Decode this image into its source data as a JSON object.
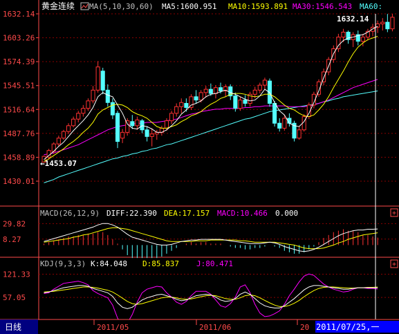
{
  "main_panel": {
    "title": "黄金连续",
    "ma_header": "MA(5,10,30,60)",
    "ma5": "MA5:1600.951",
    "ma10": "MA10:1593.891",
    "ma30": "MA30:1546.543",
    "ma60": "MA60:",
    "y_ticks": [
      "1632.14",
      "1603.26",
      "1574.39",
      "1545.51",
      "1516.64",
      "1487.76",
      "1458.89",
      "1430.01"
    ],
    "max_label": "1632.14",
    "min_label": "←1453.07"
  },
  "macd_panel": {
    "header": "MACD(26,12,9)",
    "diff": "DIFF:22.390",
    "dea": "DEA:17.157",
    "macd": "MACD:10.466",
    "extra": "0.000",
    "y_ticks": [
      "29.82",
      "8.27"
    ]
  },
  "kdj_panel": {
    "header": "KDJ(9,3,3)",
    "k": "K:84.048",
    "d": "D:85.837",
    "j": "J:80.471",
    "y_ticks": [
      "121.33",
      "57.05"
    ]
  },
  "bottom_bar": {
    "period": "日线",
    "x_labels": [
      "2011/05",
      "2011/06",
      "20"
    ],
    "cursor_date": "2011/07/25,一"
  },
  "colors": {
    "background": "#000000",
    "up": "#ff3232",
    "down": "#54ffff",
    "ma5": "#ffffff",
    "ma10": "#ffff00",
    "ma30": "#ff00ff",
    "ma60": "#00ff00",
    "grid": "#8b0000",
    "axis_text": "#ff4a4a"
  },
  "chart_data": [
    {
      "type": "candlestick",
      "title": "黄金连续",
      "ylim": [
        1430.01,
        1632.14
      ],
      "candles": [
        {
          "o": 1453,
          "h": 1461,
          "l": 1453,
          "c": 1460
        },
        {
          "o": 1459,
          "h": 1469,
          "l": 1456,
          "c": 1467
        },
        {
          "o": 1466,
          "h": 1477,
          "l": 1463,
          "c": 1475
        },
        {
          "o": 1475,
          "h": 1485,
          "l": 1472,
          "c": 1482
        },
        {
          "o": 1482,
          "h": 1492,
          "l": 1480,
          "c": 1490
        },
        {
          "o": 1490,
          "h": 1500,
          "l": 1487,
          "c": 1497
        },
        {
          "o": 1497,
          "h": 1508,
          "l": 1495,
          "c": 1505
        },
        {
          "o": 1505,
          "h": 1515,
          "l": 1501,
          "c": 1512
        },
        {
          "o": 1512,
          "h": 1522,
          "l": 1508,
          "c": 1518
        },
        {
          "o": 1518,
          "h": 1530,
          "l": 1515,
          "c": 1527
        },
        {
          "o": 1527,
          "h": 1545,
          "l": 1524,
          "c": 1540
        },
        {
          "o": 1540,
          "h": 1575,
          "l": 1537,
          "c": 1568
        },
        {
          "o": 1563,
          "h": 1567,
          "l": 1535,
          "c": 1540
        },
        {
          "o": 1540,
          "h": 1547,
          "l": 1520,
          "c": 1525
        },
        {
          "o": 1525,
          "h": 1530,
          "l": 1505,
          "c": 1510
        },
        {
          "o": 1512,
          "h": 1515,
          "l": 1470,
          "c": 1478
        },
        {
          "o": 1482,
          "h": 1493,
          "l": 1476,
          "c": 1489
        },
        {
          "o": 1489,
          "h": 1506,
          "l": 1485,
          "c": 1503
        },
        {
          "o": 1502,
          "h": 1510,
          "l": 1493,
          "c": 1497
        },
        {
          "o": 1497,
          "h": 1508,
          "l": 1492,
          "c": 1504
        },
        {
          "o": 1503,
          "h": 1505,
          "l": 1488,
          "c": 1492
        },
        {
          "o": 1492,
          "h": 1496,
          "l": 1478,
          "c": 1484
        },
        {
          "o": 1484,
          "h": 1494,
          "l": 1472,
          "c": 1487
        },
        {
          "o": 1487,
          "h": 1492,
          "l": 1480,
          "c": 1489
        },
        {
          "o": 1489,
          "h": 1497,
          "l": 1485,
          "c": 1494
        },
        {
          "o": 1494,
          "h": 1506,
          "l": 1491,
          "c": 1503
        },
        {
          "o": 1503,
          "h": 1515,
          "l": 1499,
          "c": 1512
        },
        {
          "o": 1512,
          "h": 1524,
          "l": 1508,
          "c": 1520
        },
        {
          "o": 1520,
          "h": 1530,
          "l": 1512,
          "c": 1525
        },
        {
          "o": 1524,
          "h": 1530,
          "l": 1514,
          "c": 1519
        },
        {
          "o": 1519,
          "h": 1535,
          "l": 1516,
          "c": 1532
        },
        {
          "o": 1532,
          "h": 1540,
          "l": 1524,
          "c": 1528
        },
        {
          "o": 1528,
          "h": 1540,
          "l": 1525,
          "c": 1537
        },
        {
          "o": 1537,
          "h": 1545,
          "l": 1531,
          "c": 1541
        },
        {
          "o": 1541,
          "h": 1548,
          "l": 1533,
          "c": 1536
        },
        {
          "o": 1536,
          "h": 1546,
          "l": 1530,
          "c": 1543
        },
        {
          "o": 1543,
          "h": 1549,
          "l": 1536,
          "c": 1539
        },
        {
          "o": 1539,
          "h": 1547,
          "l": 1532,
          "c": 1544
        },
        {
          "o": 1544,
          "h": 1547,
          "l": 1528,
          "c": 1533
        },
        {
          "o": 1533,
          "h": 1537,
          "l": 1514,
          "c": 1518
        },
        {
          "o": 1518,
          "h": 1532,
          "l": 1515,
          "c": 1528
        },
        {
          "o": 1528,
          "h": 1534,
          "l": 1520,
          "c": 1524
        },
        {
          "o": 1524,
          "h": 1538,
          "l": 1520,
          "c": 1535
        },
        {
          "o": 1535,
          "h": 1544,
          "l": 1530,
          "c": 1540
        },
        {
          "o": 1540,
          "h": 1549,
          "l": 1536,
          "c": 1546
        },
        {
          "o": 1546,
          "h": 1555,
          "l": 1540,
          "c": 1552
        },
        {
          "o": 1551,
          "h": 1554,
          "l": 1520,
          "c": 1524
        },
        {
          "o": 1524,
          "h": 1527,
          "l": 1496,
          "c": 1500
        },
        {
          "o": 1500,
          "h": 1506,
          "l": 1490,
          "c": 1494
        },
        {
          "o": 1494,
          "h": 1510,
          "l": 1491,
          "c": 1506
        },
        {
          "o": 1506,
          "h": 1512,
          "l": 1496,
          "c": 1500
        },
        {
          "o": 1500,
          "h": 1503,
          "l": 1478,
          "c": 1482
        },
        {
          "o": 1482,
          "h": 1496,
          "l": 1480,
          "c": 1492
        },
        {
          "o": 1492,
          "h": 1511,
          "l": 1490,
          "c": 1508
        },
        {
          "o": 1508,
          "h": 1525,
          "l": 1505,
          "c": 1522
        },
        {
          "o": 1522,
          "h": 1538,
          "l": 1518,
          "c": 1535
        },
        {
          "o": 1535,
          "h": 1553,
          "l": 1532,
          "c": 1550
        },
        {
          "o": 1550,
          "h": 1566,
          "l": 1546,
          "c": 1562
        },
        {
          "o": 1562,
          "h": 1580,
          "l": 1558,
          "c": 1577
        },
        {
          "o": 1577,
          "h": 1594,
          "l": 1573,
          "c": 1590
        },
        {
          "o": 1590,
          "h": 1608,
          "l": 1586,
          "c": 1604
        },
        {
          "o": 1604,
          "h": 1614,
          "l": 1598,
          "c": 1610
        },
        {
          "o": 1610,
          "h": 1612,
          "l": 1596,
          "c": 1601
        },
        {
          "o": 1601,
          "h": 1610,
          "l": 1592,
          "c": 1607
        },
        {
          "o": 1607,
          "h": 1612,
          "l": 1594,
          "c": 1599
        },
        {
          "o": 1599,
          "h": 1608,
          "l": 1593,
          "c": 1604
        },
        {
          "o": 1604,
          "h": 1614,
          "l": 1600,
          "c": 1611
        },
        {
          "o": 1611,
          "h": 1620,
          "l": 1605,
          "c": 1616
        },
        {
          "o": 1616,
          "h": 1624,
          "l": 1609,
          "c": 1620
        },
        {
          "o": 1620,
          "h": 1627,
          "l": 1612,
          "c": 1622
        },
        {
          "o": 1622,
          "h": 1632,
          "l": 1610,
          "c": 1614
        },
        {
          "o": 1614,
          "h": 1632,
          "l": 1611,
          "c": 1628
        }
      ],
      "ma5": [
        1456,
        1461,
        1466,
        1472,
        1477,
        1484,
        1491,
        1497,
        1503,
        1510,
        1519,
        1532,
        1537,
        1534,
        1532,
        1522,
        1512,
        1499,
        1494,
        1493,
        1497,
        1496,
        1493,
        1489,
        1489,
        1492,
        1497,
        1503,
        1511,
        1516,
        1522,
        1524,
        1527,
        1532,
        1535,
        1536,
        1538,
        1540,
        1537,
        1535,
        1532,
        1529,
        1527,
        1528,
        1533,
        1541,
        1537,
        1525,
        1515,
        1510,
        1500,
        1497,
        1496,
        1502,
        1512,
        1525,
        1539,
        1555,
        1569,
        1584,
        1594,
        1600,
        1603,
        1604,
        1606,
        1607,
        1610,
        1614,
        1617
      ],
      "ma10": [
        1454,
        1457,
        1461,
        1465,
        1469,
        1474,
        1478,
        1483,
        1489,
        1494,
        1501,
        1511,
        1516,
        1519,
        1522,
        1523,
        1522,
        1519,
        1514,
        1511,
        1509,
        1506,
        1501,
        1496,
        1494,
        1494,
        1496,
        1498,
        1502,
        1505,
        1509,
        1511,
        1514,
        1519,
        1523,
        1526,
        1530,
        1532,
        1535,
        1536,
        1536,
        1535,
        1533,
        1532,
        1533,
        1535,
        1535,
        1532,
        1527,
        1522,
        1518,
        1516,
        1512,
        1509,
        1508,
        1510,
        1516,
        1523,
        1532,
        1543,
        1553,
        1563,
        1574,
        1584,
        1592,
        1597,
        1601,
        1603,
        1605
      ],
      "ma30": [
        1462,
        1463,
        1464,
        1466,
        1468,
        1470,
        1472,
        1474,
        1477,
        1480,
        1483,
        1486,
        1489,
        1492,
        1494,
        1496,
        1497,
        1498,
        1499,
        1500,
        1500,
        1501,
        1501,
        1501,
        1502,
        1503,
        1504,
        1505,
        1507,
        1509,
        1511,
        1512,
        1514,
        1515,
        1516,
        1517,
        1517,
        1518,
        1518,
        1518,
        1518,
        1519,
        1519,
        1520,
        1520,
        1521,
        1521,
        1521,
        1521,
        1521,
        1520,
        1520,
        1520,
        1520,
        1521,
        1522,
        1524,
        1526,
        1528,
        1531,
        1534,
        1537,
        1540,
        1543,
        1545,
        1547,
        1549,
        1551,
        1553
      ],
      "ma60": [
        1428,
        1430,
        1432,
        1435,
        1437,
        1439,
        1441,
        1443,
        1445,
        1447,
        1449,
        1451,
        1453,
        1455,
        1457,
        1458,
        1460,
        1461,
        1463,
        1464,
        1466,
        1467,
        1469,
        1470,
        1472,
        1474,
        1475,
        1477,
        1479,
        1481,
        1483,
        1485,
        1487,
        1489,
        1491,
        1493,
        1495,
        1497,
        1499,
        1501,
        1503,
        1505,
        1506,
        1508,
        1510,
        1512,
        1514,
        1515,
        1516,
        1517,
        1518,
        1519,
        1520,
        1521,
        1522,
        1523,
        1524,
        1526,
        1527,
        1529,
        1530,
        1532,
        1533,
        1534,
        1535,
        1536,
        1537,
        1538,
        1539
      ]
    },
    {
      "type": "macd",
      "title": "MACD(26,12,9)",
      "ylim": [
        -15,
        35
      ],
      "diff": [
        5,
        7,
        9,
        11,
        13,
        15,
        17,
        19,
        21,
        23,
        25,
        28,
        30,
        30,
        28,
        25,
        20,
        15,
        11,
        9,
        7,
        5,
        3,
        1,
        0,
        0,
        1,
        3,
        5,
        6,
        7,
        7,
        8,
        8,
        8,
        8,
        8,
        7,
        6,
        5,
        4,
        3,
        2,
        2,
        2,
        3,
        4,
        3,
        1,
        -2,
        -4,
        -6,
        -8,
        -9,
        -8,
        -6,
        -3,
        1,
        5,
        9,
        13,
        16,
        18,
        20,
        21,
        21,
        22,
        22,
        22.39
      ],
      "dea": [
        4,
        5,
        6,
        7,
        8,
        9,
        11,
        12,
        14,
        15,
        17,
        19,
        21,
        23,
        24,
        24,
        23,
        22,
        20,
        18,
        16,
        14,
        12,
        10,
        8,
        6,
        5,
        5,
        5,
        5,
        5,
        6,
        6,
        6,
        7,
        7,
        7,
        7,
        7,
        7,
        6,
        6,
        5,
        4,
        4,
        4,
        4,
        4,
        3,
        2,
        1,
        0,
        -2,
        -4,
        -5,
        -5,
        -5,
        -4,
        -2,
        0,
        3,
        5,
        8,
        10,
        12,
        14,
        15,
        16,
        17.157
      ],
      "macd_bars": [
        2,
        4,
        6,
        8,
        10,
        12,
        12,
        14,
        14,
        16,
        16,
        18,
        18,
        14,
        8,
        2,
        -6,
        -14,
        -18,
        -18,
        -18,
        -18,
        -18,
        -18,
        -16,
        -12,
        -8,
        -4,
        0,
        2,
        4,
        2,
        4,
        4,
        2,
        2,
        2,
        0,
        -2,
        -4,
        -4,
        -6,
        -6,
        -4,
        -4,
        -2,
        0,
        -2,
        -4,
        -8,
        -10,
        -12,
        -12,
        -10,
        -6,
        -2,
        4,
        10,
        14,
        18,
        20,
        22,
        20,
        20,
        18,
        14,
        14,
        12,
        10.466
      ]
    },
    {
      "type": "kdj",
      "title": "KDJ(9,3,3)",
      "ylim": [
        0,
        130
      ],
      "k": [
        70,
        72,
        76,
        80,
        84,
        86,
        88,
        90,
        90,
        88,
        82,
        78,
        74,
        70,
        60,
        42,
        30,
        26,
        30,
        40,
        50,
        56,
        60,
        64,
        66,
        62,
        58,
        52,
        48,
        50,
        56,
        62,
        64,
        66,
        64,
        58,
        50,
        46,
        48,
        54,
        66,
        72,
        66,
        54,
        42,
        34,
        30,
        28,
        28,
        34,
        44,
        54,
        66,
        78,
        86,
        90,
        90,
        88,
        86,
        84,
        82,
        80,
        80,
        82,
        84,
        84,
        84,
        84,
        84.048
      ],
      "d": [
        72,
        73,
        74,
        76,
        78,
        80,
        82,
        84,
        86,
        86,
        85,
        83,
        80,
        77,
        72,
        64,
        55,
        46,
        40,
        38,
        40,
        44,
        48,
        52,
        56,
        58,
        58,
        56,
        53,
        52,
        53,
        56,
        59,
        62,
        63,
        62,
        58,
        54,
        52,
        52,
        56,
        62,
        64,
        62,
        56,
        49,
        42,
        36,
        32,
        32,
        35,
        41,
        49,
        59,
        68,
        76,
        82,
        85,
        86,
        86,
        85,
        84,
        83,
        83,
        84,
        84,
        85,
        85,
        85.837
      ],
      "j": [
        68,
        70,
        80,
        88,
        96,
        98,
        100,
        102,
        98,
        92,
        76,
        68,
        62,
        56,
        36,
        0,
        -20,
        -14,
        10,
        44,
        70,
        80,
        84,
        88,
        86,
        70,
        58,
        44,
        38,
        46,
        62,
        74,
        74,
        74,
        66,
        50,
        34,
        30,
        40,
        58,
        86,
        92,
        70,
        38,
        14,
        4,
        6,
        12,
        20,
        38,
        62,
        80,
        100,
        116,
        122,
        118,
        106,
        94,
        86,
        80,
        76,
        72,
        74,
        80,
        84,
        84,
        82,
        82,
        80.471
      ]
    }
  ]
}
